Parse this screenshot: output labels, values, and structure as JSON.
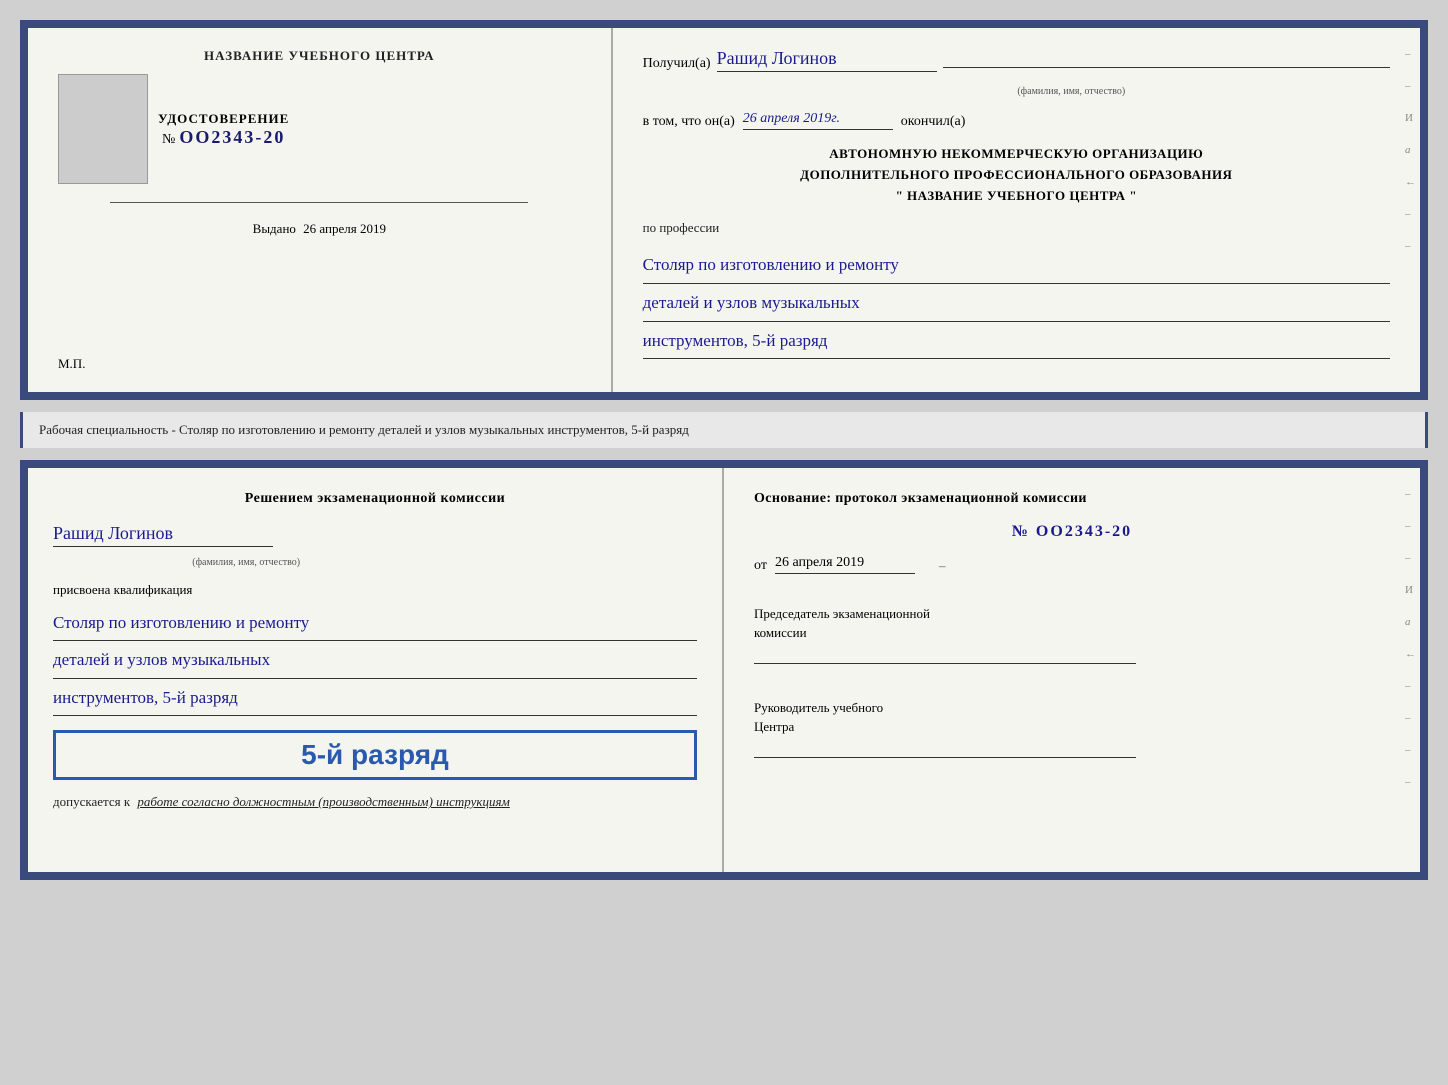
{
  "top_cert": {
    "left": {
      "section_title": "НАЗВАНИЕ УЧЕБНОГО ЦЕНТРА",
      "udostoverenie_label": "УДОСТОВЕРЕНИЕ",
      "number_prefix": "№",
      "number": "OO2343-20",
      "issued_label": "Выдано",
      "issued_date": "26 апреля 2019",
      "mp": "М.П."
    },
    "right": {
      "poluchil_label": "Получил(а)",
      "recipient_name": "Рашид Логинов",
      "fio_sub": "(фамилия, имя, отчество)",
      "vtom_label": "в том, что он(а)",
      "date_value": "26 апреля 2019г.",
      "okonchil_label": "окончил(а)",
      "org_line1": "АВТОНОМНУЮ НЕКОММЕРЧЕСКУЮ ОРГАНИЗАЦИЮ",
      "org_line2": "ДОПОЛНИТЕЛЬНОГО ПРОФЕССИОНАЛЬНОГО ОБРАЗОВАНИЯ",
      "org_line3": "\"   НАЗВАНИЕ УЧЕБНОГО ЦЕНТРА   \"",
      "po_professii_label": "по профессии",
      "profession_line1": "Столяр по изготовлению и ремонту",
      "profession_line2": "деталей и узлов музыкальных",
      "profession_line3": "инструментов, 5-й разряд"
    }
  },
  "middle": {
    "text": "Рабочая специальность - Столяр по изготовлению и ремонту деталей и узлов музыкальных инструментов, 5-й разряд"
  },
  "bottom_cert": {
    "left": {
      "resheniem_label": "Решением экзаменационной комиссии",
      "name": "Рашид Логинов",
      "fio_sub": "(фамилия, имя, отчество)",
      "prisvoena_label": "присвоена квалификация",
      "profession_line1": "Столяр по изготовлению и ремонту",
      "profession_line2": "деталей и узлов музыкальных",
      "profession_line3": "инструментов, 5-й разряд",
      "rank_highlight": "5-й разряд",
      "dopuskaetsya_label": "допускается к",
      "dopuskaetsya_value": "работе согласно должностным (производственным) инструкциям"
    },
    "right": {
      "osnovanie_label": "Основание: протокол экзаменационной комиссии",
      "number_prefix": "№",
      "number": "OO2343-20",
      "ot_label": "от",
      "ot_date": "26 апреля 2019",
      "predsedatel_line1": "Председатель экзаменационной",
      "predsedatel_line2": "комиссии",
      "rukovoditel_line1": "Руководитель учебного",
      "rukovoditel_line2": "Центра"
    }
  },
  "right_edge_chars": [
    "И",
    "а",
    "←",
    "–",
    "–",
    "–",
    "–"
  ]
}
